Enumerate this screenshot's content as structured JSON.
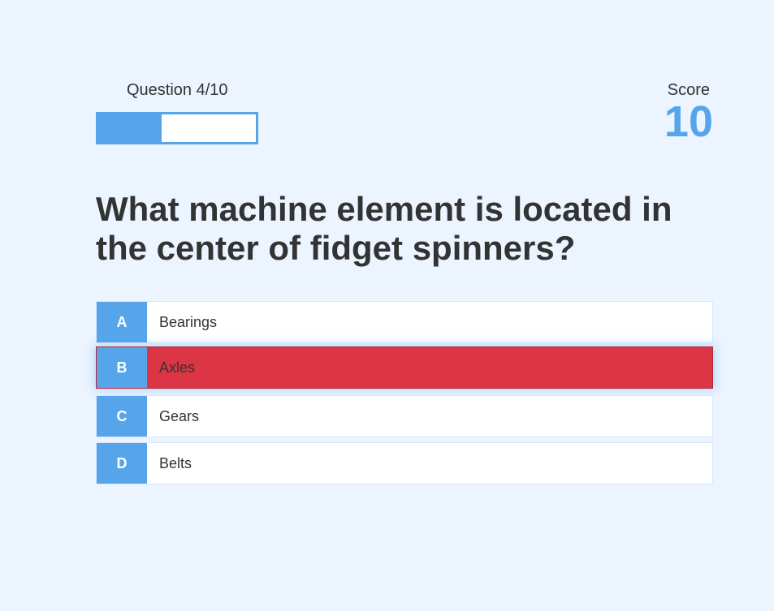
{
  "hud": {
    "question_counter": "Question 4/10",
    "progress_fraction": 0.4,
    "score_label": "Score",
    "score_value": "10"
  },
  "question": {
    "text": "What machine element is located in the center of fidget spinners?"
  },
  "choices": [
    {
      "prefix": "A",
      "text": "Bearings",
      "state": "default"
    },
    {
      "prefix": "B",
      "text": "Axles",
      "state": "incorrect"
    },
    {
      "prefix": "C",
      "text": "Gears",
      "state": "default"
    },
    {
      "prefix": "D",
      "text": "Belts",
      "state": "default"
    }
  ],
  "colors": {
    "background": "#ebf4ff",
    "accent": "#56a5eb",
    "incorrect": "#dc3545",
    "text": "#333333"
  }
}
